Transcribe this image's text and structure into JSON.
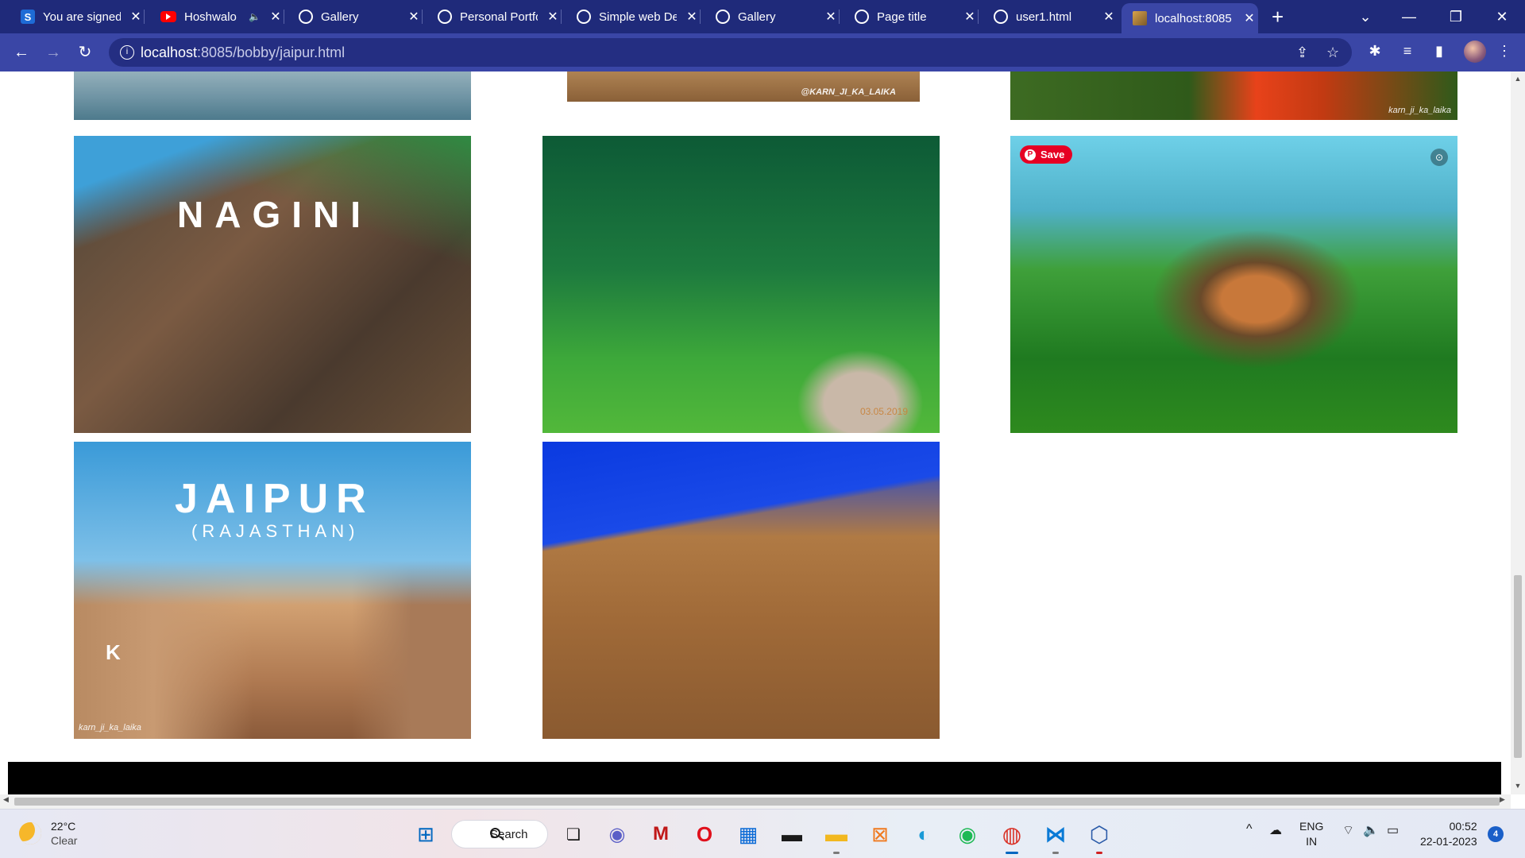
{
  "browser": {
    "tabs": [
      {
        "title": "You are signed",
        "favicon": "s-app-icon",
        "close": "✕"
      },
      {
        "title": "Hoshwalo",
        "favicon": "youtube-icon",
        "close": "✕",
        "audio": "🔈"
      },
      {
        "title": "Gallery",
        "favicon": "globe-icon",
        "close": "✕"
      },
      {
        "title": "Personal Portfo",
        "favicon": "globe-icon",
        "close": "✕"
      },
      {
        "title": "Simple web De",
        "favicon": "globe-icon",
        "close": "✕"
      },
      {
        "title": "Gallery",
        "favicon": "globe-icon",
        "close": "✕"
      },
      {
        "title": "Page title",
        "favicon": "globe-icon",
        "close": "✕"
      },
      {
        "title": "user1.html",
        "favicon": "globe-icon",
        "close": "✕"
      },
      {
        "title": "localhost:8085",
        "favicon": "image-icon",
        "close": "✕"
      }
    ],
    "new_tab": "+",
    "tab_search": "⌄",
    "minimize": "—",
    "restore": "❐",
    "close_window": "✕",
    "back": "←",
    "forward": "→",
    "reload": "↻",
    "address_host": "localhost",
    "address_rest": ":8085/bobby/jaipur.html",
    "info": "i",
    "share_icon": "⇪",
    "bookmark_icon": "☆",
    "extensions_icon": "✱",
    "media_icon": "≡",
    "sidepanel_icon": "▮",
    "menu_icon": "⋮"
  },
  "gallery": {
    "images": [
      {
        "id": "lake",
        "label": ""
      },
      {
        "id": "rock-top",
        "label": "",
        "watermark": "@KARN_JI_KA_LAIKA"
      },
      {
        "id": "red-river",
        "label": "",
        "watermark": "karn_ji_ka_laika"
      },
      {
        "id": "nagini",
        "label": "NAGINI"
      },
      {
        "id": "forest",
        "label": "",
        "watermark": "03.05.2019"
      },
      {
        "id": "watch",
        "label": "",
        "save_button": "Save",
        "lens_icon": "⊙"
      },
      {
        "id": "jaipur",
        "label": "JAIPUR",
        "sublabel": "(RAJASTHAN)",
        "watermark": "karn_ji_ka_laika",
        "logo_letter": "K"
      },
      {
        "id": "canyon",
        "label": ""
      }
    ]
  },
  "scrollbars": {
    "up": "▲",
    "down": "▼",
    "left": "◀",
    "right": "▶"
  },
  "taskbar": {
    "weather_temp": "22°C",
    "weather_desc": "Clear",
    "search_label": "Search",
    "apps": [
      {
        "name": "start-icon",
        "glyph": "⊞",
        "color": "#0067c0"
      },
      {
        "name": "task-view-icon",
        "glyph": "❏",
        "color": "#1a1a1a"
      },
      {
        "name": "teams-icon",
        "glyph": "◉",
        "color": "#5b5fc7"
      },
      {
        "name": "mcafee-icon",
        "glyph": "M",
        "color": "#c01818"
      },
      {
        "name": "opera-icon",
        "glyph": "O",
        "color": "#e0101c"
      },
      {
        "name": "store-icon",
        "glyph": "▦",
        "color": "#0a6ad6"
      },
      {
        "name": "terminal-icon",
        "glyph": "▬",
        "color": "#1a1a1a"
      },
      {
        "name": "file-explorer-icon",
        "glyph": "▬",
        "color": "#f2b820"
      },
      {
        "name": "xampp-icon",
        "glyph": "⊠",
        "color": "#f07a20"
      },
      {
        "name": "edge-icon",
        "glyph": "◐",
        "color": "#1a9ad6"
      },
      {
        "name": "spotify-icon",
        "glyph": "◉",
        "color": "#1db954"
      },
      {
        "name": "chrome-icon",
        "glyph": "◍",
        "color": "#d93025"
      },
      {
        "name": "vscode-icon",
        "glyph": "⋈",
        "color": "#0a7ad6"
      },
      {
        "name": "virtualbox-icon",
        "glyph": "⬡",
        "color": "#2a5aa8"
      }
    ],
    "tray_chevron": "^",
    "language": "ENG",
    "region": "IN",
    "time": "00:52",
    "date": "22-01-2023",
    "notifications": "4"
  }
}
